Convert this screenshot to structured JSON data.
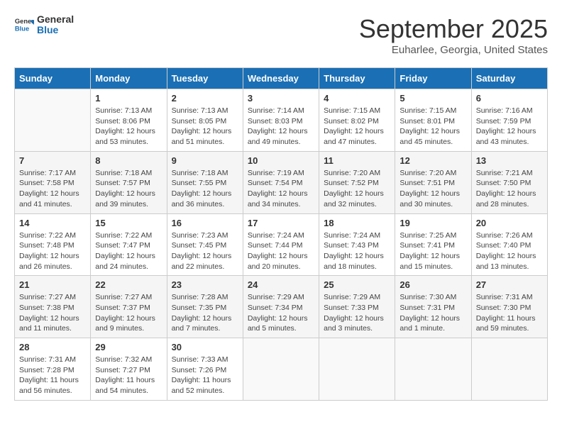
{
  "header": {
    "logo_general": "General",
    "logo_blue": "Blue",
    "month": "September 2025",
    "location": "Euharlee, Georgia, United States"
  },
  "weekdays": [
    "Sunday",
    "Monday",
    "Tuesday",
    "Wednesday",
    "Thursday",
    "Friday",
    "Saturday"
  ],
  "weeks": [
    [
      {
        "day": "",
        "info": ""
      },
      {
        "day": "1",
        "info": "Sunrise: 7:13 AM\nSunset: 8:06 PM\nDaylight: 12 hours\nand 53 minutes."
      },
      {
        "day": "2",
        "info": "Sunrise: 7:13 AM\nSunset: 8:05 PM\nDaylight: 12 hours\nand 51 minutes."
      },
      {
        "day": "3",
        "info": "Sunrise: 7:14 AM\nSunset: 8:03 PM\nDaylight: 12 hours\nand 49 minutes."
      },
      {
        "day": "4",
        "info": "Sunrise: 7:15 AM\nSunset: 8:02 PM\nDaylight: 12 hours\nand 47 minutes."
      },
      {
        "day": "5",
        "info": "Sunrise: 7:15 AM\nSunset: 8:01 PM\nDaylight: 12 hours\nand 45 minutes."
      },
      {
        "day": "6",
        "info": "Sunrise: 7:16 AM\nSunset: 7:59 PM\nDaylight: 12 hours\nand 43 minutes."
      }
    ],
    [
      {
        "day": "7",
        "info": "Sunrise: 7:17 AM\nSunset: 7:58 PM\nDaylight: 12 hours\nand 41 minutes."
      },
      {
        "day": "8",
        "info": "Sunrise: 7:18 AM\nSunset: 7:57 PM\nDaylight: 12 hours\nand 39 minutes."
      },
      {
        "day": "9",
        "info": "Sunrise: 7:18 AM\nSunset: 7:55 PM\nDaylight: 12 hours\nand 36 minutes."
      },
      {
        "day": "10",
        "info": "Sunrise: 7:19 AM\nSunset: 7:54 PM\nDaylight: 12 hours\nand 34 minutes."
      },
      {
        "day": "11",
        "info": "Sunrise: 7:20 AM\nSunset: 7:52 PM\nDaylight: 12 hours\nand 32 minutes."
      },
      {
        "day": "12",
        "info": "Sunrise: 7:20 AM\nSunset: 7:51 PM\nDaylight: 12 hours\nand 30 minutes."
      },
      {
        "day": "13",
        "info": "Sunrise: 7:21 AM\nSunset: 7:50 PM\nDaylight: 12 hours\nand 28 minutes."
      }
    ],
    [
      {
        "day": "14",
        "info": "Sunrise: 7:22 AM\nSunset: 7:48 PM\nDaylight: 12 hours\nand 26 minutes."
      },
      {
        "day": "15",
        "info": "Sunrise: 7:22 AM\nSunset: 7:47 PM\nDaylight: 12 hours\nand 24 minutes."
      },
      {
        "day": "16",
        "info": "Sunrise: 7:23 AM\nSunset: 7:45 PM\nDaylight: 12 hours\nand 22 minutes."
      },
      {
        "day": "17",
        "info": "Sunrise: 7:24 AM\nSunset: 7:44 PM\nDaylight: 12 hours\nand 20 minutes."
      },
      {
        "day": "18",
        "info": "Sunrise: 7:24 AM\nSunset: 7:43 PM\nDaylight: 12 hours\nand 18 minutes."
      },
      {
        "day": "19",
        "info": "Sunrise: 7:25 AM\nSunset: 7:41 PM\nDaylight: 12 hours\nand 15 minutes."
      },
      {
        "day": "20",
        "info": "Sunrise: 7:26 AM\nSunset: 7:40 PM\nDaylight: 12 hours\nand 13 minutes."
      }
    ],
    [
      {
        "day": "21",
        "info": "Sunrise: 7:27 AM\nSunset: 7:38 PM\nDaylight: 12 hours\nand 11 minutes."
      },
      {
        "day": "22",
        "info": "Sunrise: 7:27 AM\nSunset: 7:37 PM\nDaylight: 12 hours\nand 9 minutes."
      },
      {
        "day": "23",
        "info": "Sunrise: 7:28 AM\nSunset: 7:35 PM\nDaylight: 12 hours\nand 7 minutes."
      },
      {
        "day": "24",
        "info": "Sunrise: 7:29 AM\nSunset: 7:34 PM\nDaylight: 12 hours\nand 5 minutes."
      },
      {
        "day": "25",
        "info": "Sunrise: 7:29 AM\nSunset: 7:33 PM\nDaylight: 12 hours\nand 3 minutes."
      },
      {
        "day": "26",
        "info": "Sunrise: 7:30 AM\nSunset: 7:31 PM\nDaylight: 12 hours\nand 1 minute."
      },
      {
        "day": "27",
        "info": "Sunrise: 7:31 AM\nSunset: 7:30 PM\nDaylight: 11 hours\nand 59 minutes."
      }
    ],
    [
      {
        "day": "28",
        "info": "Sunrise: 7:31 AM\nSunset: 7:28 PM\nDaylight: 11 hours\nand 56 minutes."
      },
      {
        "day": "29",
        "info": "Sunrise: 7:32 AM\nSunset: 7:27 PM\nDaylight: 11 hours\nand 54 minutes."
      },
      {
        "day": "30",
        "info": "Sunrise: 7:33 AM\nSunset: 7:26 PM\nDaylight: 11 hours\nand 52 minutes."
      },
      {
        "day": "",
        "info": ""
      },
      {
        "day": "",
        "info": ""
      },
      {
        "day": "",
        "info": ""
      },
      {
        "day": "",
        "info": ""
      }
    ]
  ]
}
